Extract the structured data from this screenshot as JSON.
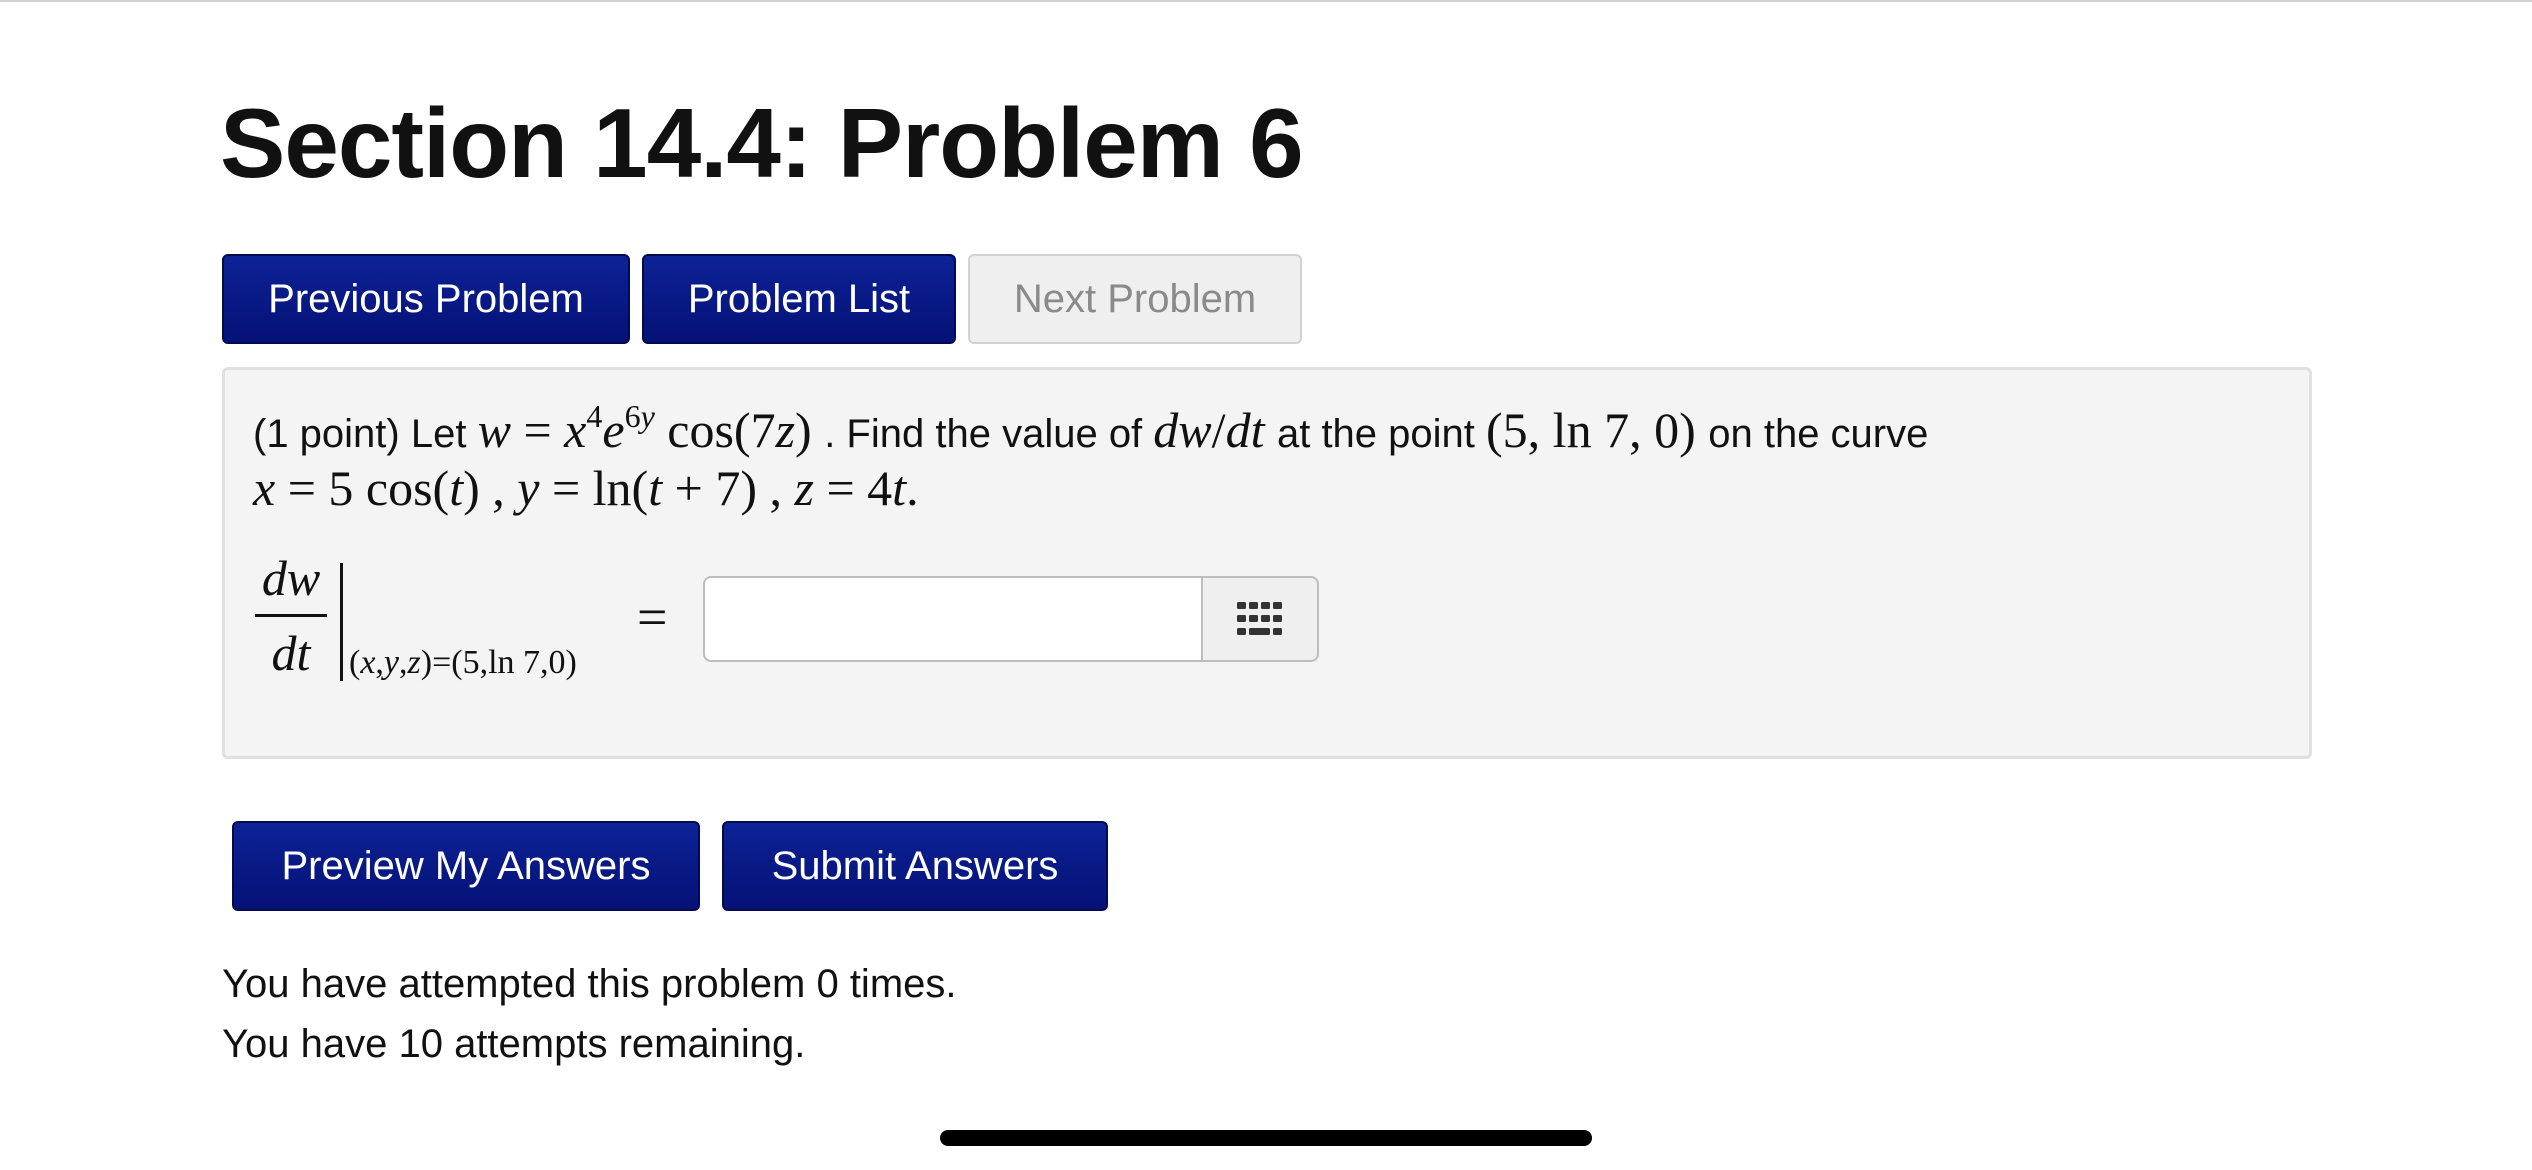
{
  "page": {
    "title": "Section 14.4: Problem 6"
  },
  "nav": {
    "previous_label": "Previous Problem",
    "list_label": "Problem List",
    "next_label": "Next Problem"
  },
  "problem": {
    "points": "(1 point) Let",
    "text_find": ". Find the value of",
    "text_at_point": "at the point",
    "text_on_curve": "on the curve",
    "answer_value": "",
    "answer_placeholder": ""
  },
  "actions": {
    "preview_label": "Preview My Answers",
    "submit_label": "Submit Answers"
  },
  "status": {
    "attempted": "You have attempted this problem 0 times.",
    "remaining": "You have 10 attempts remaining."
  },
  "icons": {
    "keypad": "keypad-grid-icon"
  },
  "colors": {
    "primary_button": "#051176",
    "disabled_button": "#efefef",
    "problem_background": "#f4f4f4"
  }
}
